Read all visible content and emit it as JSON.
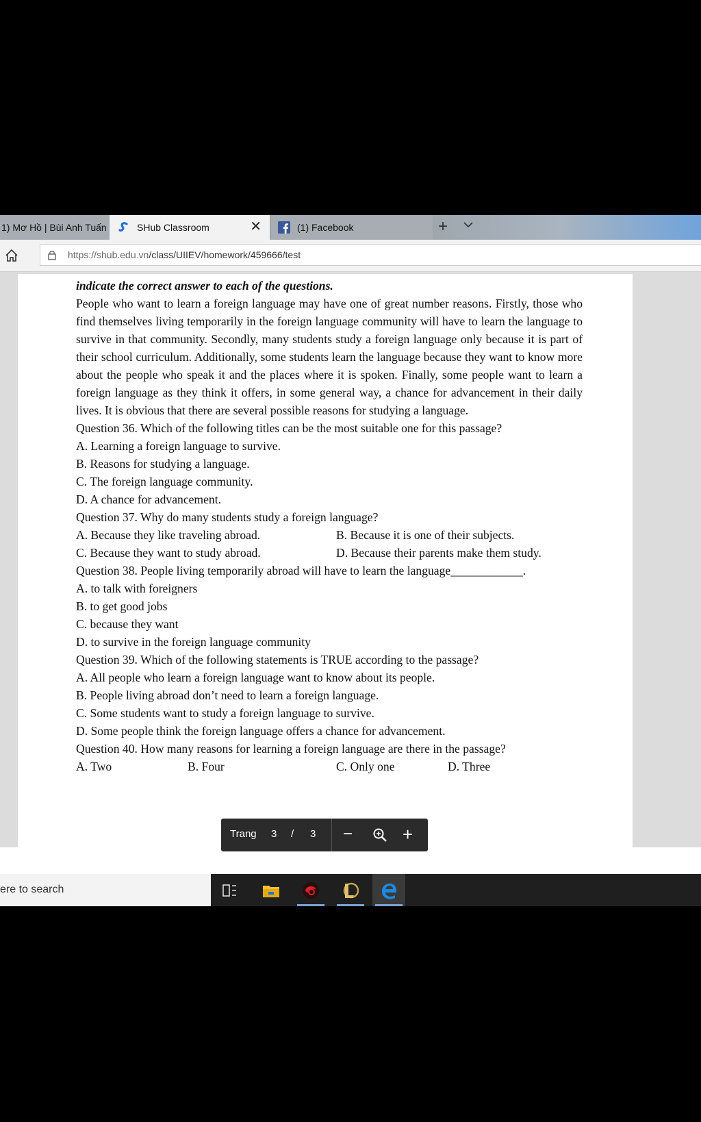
{
  "browser": {
    "tabs": [
      {
        "label": "1) Mơ Hồ | Bùi Anh Tuấn"
      },
      {
        "label": "SHub Classroom"
      },
      {
        "label": "(1) Facebook"
      }
    ],
    "new_tab": "+",
    "close": "✕",
    "url_host": "https://shub.edu.vn",
    "url_path": "/class/UIIEV/homework/459666/test"
  },
  "document": {
    "instruction": "indicate the correct answer to each of the questions.",
    "passage": "People who want to learn a foreign language may have one of great number reasons. Firstly, those who find themselves living temporarily in the foreign language community will have to learn the language to survive in that community. Secondly, many students study a foreign language only because it is part of their school curriculum. Additionally, some students learn the language because they want to know more about the people who speak it and the places where it is spoken. Finally, some people want to learn a foreign language as they think it offers, in some general way, a chance for advancement in their daily lives. It is obvious that there are several possible reasons for studying a language.",
    "q36": {
      "question": "Question 36. Which of the following titles can be the most suitable one for this passage?",
      "a": "A. Learning a foreign language to survive.",
      "b": "B. Reasons for studying a language.",
      "c": "C. The foreign language community.",
      "d": "D. A chance for advancement."
    },
    "q37": {
      "question": "Question 37. Why do many students study a foreign language?",
      "a": "A. Because they like traveling abroad.",
      "b": "B. Because it is one of their subjects.",
      "c": "C. Because they want to study abroad.",
      "d": "D. Because their parents make them study."
    },
    "q38": {
      "question": "Question 38. People living temporarily abroad will have to learn the language____________.",
      "a": "A. to talk with foreigners",
      "b": "B. to get good jobs",
      "c": "C. because they want",
      "d": "D. to survive in the foreign language community"
    },
    "q39": {
      "question": "Question 39. Which of the following statements is TRUE according to the passage?",
      "a": "A. All people who learn a foreign language want to know about its people.",
      "b": "B. People living abroad don’t need to learn a foreign language.",
      "c": "C. Some students want to study a foreign language to survive.",
      "d": "D. Some people think the foreign language offers a chance for advancement."
    },
    "q40": {
      "question": "Question 40.  How many reasons for learning a foreign language are there in the passage?",
      "a": "A. Two",
      "b": "B. Four",
      "c": "C. Only one",
      "d": "D. Three"
    }
  },
  "pdf_toolbar": {
    "page_label": "Trang",
    "current_page": "3",
    "separator": "/",
    "total_pages": "3",
    "zoom_out": "−",
    "zoom_in": "+"
  },
  "taskbar": {
    "search_text": "ere to search"
  }
}
